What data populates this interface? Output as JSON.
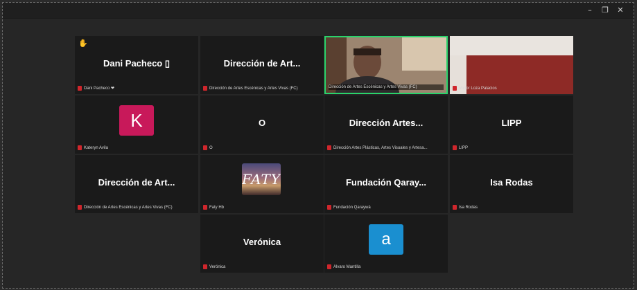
{
  "window": {
    "minimize_icon": "minimize-icon",
    "restore_icon": "restore-icon",
    "close_icon": "close-icon"
  },
  "colors": {
    "mute": "#d0262c",
    "active_speaker_border": "#2ad36b",
    "avatar_k": "#c8195a",
    "avatar_a": "#1a8fd0"
  },
  "tiles": [
    {
      "name": "Dani Pacheco ▯",
      "caption": "Dani Pacheco ❤",
      "hand_raised": true
    },
    {
      "name": "Dirección de Art...",
      "caption": "Dirección de Artes Escénicas y Artes Vivas (FC)"
    },
    {
      "name": "",
      "caption": "Dirección de Artes Escénicas y Artes Vivas (FC)",
      "video": true,
      "active_speaker": true
    },
    {
      "name": "",
      "caption": "Víctor Loza Palacios",
      "video": true
    },
    {
      "name": "",
      "caption": "Kateryn Avila",
      "avatar_letter": "K"
    },
    {
      "name": "O",
      "caption": "O"
    },
    {
      "name": "Dirección Artes...",
      "caption": "Dirección Artes Plásticas, Artes Visuales y Artesa..."
    },
    {
      "name": "LIPP",
      "caption": "LIPP"
    },
    {
      "name": "Dirección de Art...",
      "caption": "Dirección de Artes Escénicas y Artes Vivas (FC)"
    },
    {
      "name": "",
      "caption": "Faty Hb",
      "avatar_text": "FATY"
    },
    {
      "name": "Fundación Qaray...",
      "caption": "Fundación Qaraywá"
    },
    {
      "name": "Isa Rodas",
      "caption": "Isa Rodas"
    },
    {
      "name": "Verónica",
      "caption": "Verónica"
    },
    {
      "name": "",
      "caption": "Álvaro Mantilla",
      "avatar_letter": "a"
    }
  ]
}
